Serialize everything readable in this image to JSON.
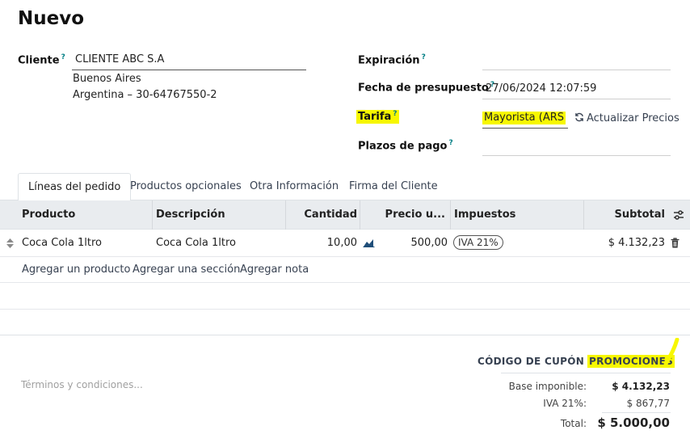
{
  "page": {
    "title": "Nuevo"
  },
  "customer": {
    "label": "Cliente",
    "help": "?",
    "name": "CLIENTE ABC S.A",
    "city": "Buenos Aires",
    "country_vat": "Argentina – 30-64767550-2"
  },
  "right_fields": {
    "expiration": {
      "label": "Expiración",
      "help": "?",
      "value": ""
    },
    "quote_date": {
      "label": "Fecha de presupuesto",
      "help": "?",
      "value": "27/06/2024 12:07:59"
    },
    "pricelist": {
      "label": "Tarifa",
      "help": "?",
      "value": "Mayorista (ARS"
    },
    "payment_terms": {
      "label": "Plazos de pago",
      "help": "?",
      "value": ""
    },
    "update_prices_label": "Actualizar Precios"
  },
  "tabs": [
    {
      "label": "Líneas del pedido",
      "active": true
    },
    {
      "label": "Productos opcionales",
      "active": false
    },
    {
      "label": "Otra Información",
      "active": false
    },
    {
      "label": "Firma del Cliente",
      "active": false
    }
  ],
  "table": {
    "headers": {
      "product": "Producto",
      "description": "Descripción",
      "quantity": "Cantidad",
      "price": "Precio u...",
      "taxes": "Impuestos",
      "subtotal": "Subtotal"
    },
    "rows": [
      {
        "product": "Coca Cola 1ltro",
        "description": "Coca Cola 1ltro",
        "quantity": "10,00",
        "price": "500,00",
        "tax": "IVA 21%",
        "subtotal": "$ 4.132,23"
      }
    ],
    "actions": {
      "add_product": "Agregar un producto",
      "add_section": "Agregar una sección",
      "add_note": "Agregar nota"
    }
  },
  "footer": {
    "coupon": "CÓDIGO DE CUPÓN",
    "promotions": "PROMOCIONES",
    "terms_placeholder": "Términos y condiciones...",
    "totals": {
      "base_label": "Base imponible:",
      "base_value": "$ 4.132,23",
      "vat_label": "IVA 21%:",
      "vat_value": "$ 867,77",
      "total_label": "Total:",
      "total_value": "$ 5.000,00"
    }
  },
  "colors": {
    "highlight": "#f7f700",
    "accent": "#017e84",
    "header_bg": "#e9ecef"
  }
}
